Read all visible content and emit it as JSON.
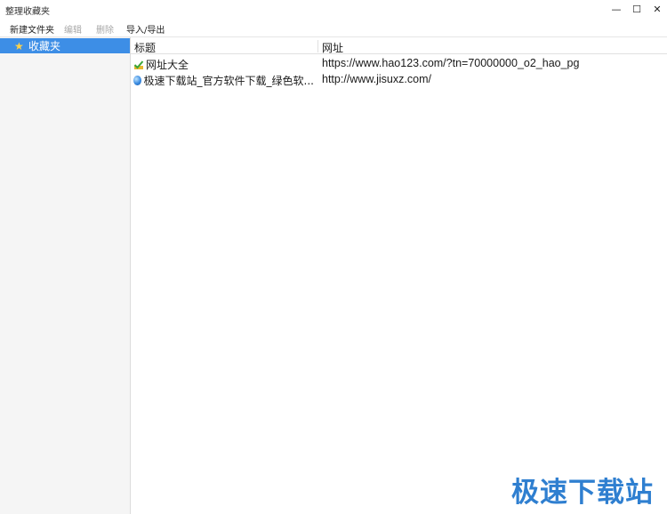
{
  "window": {
    "title": "整理收藏夹",
    "controls": {
      "minimize": "—",
      "maximize": "☐",
      "close": "✕"
    }
  },
  "toolbar": {
    "new_folder": "新建文件夹",
    "edit": "编辑",
    "delete": "删除",
    "import_export": "导入/导出"
  },
  "sidebar": {
    "items": [
      {
        "label": "收藏夹",
        "icon": "star-icon",
        "selected": true
      }
    ]
  },
  "table": {
    "columns": [
      "标题",
      "网址"
    ],
    "rows": [
      {
        "title": "网址大全",
        "url": "https://www.hao123.com/?tn=70000000_o2_hao_pg",
        "icon": "check-favicon"
      },
      {
        "title": "极速下载站_官方软件下载_绿色软...",
        "url": "http://www.jisuxz.com/",
        "icon": "globe-icon"
      }
    ]
  },
  "watermark": "极速下载站",
  "colors": {
    "selection": "#3d8ee6",
    "watermark": "#2f7fd0"
  }
}
